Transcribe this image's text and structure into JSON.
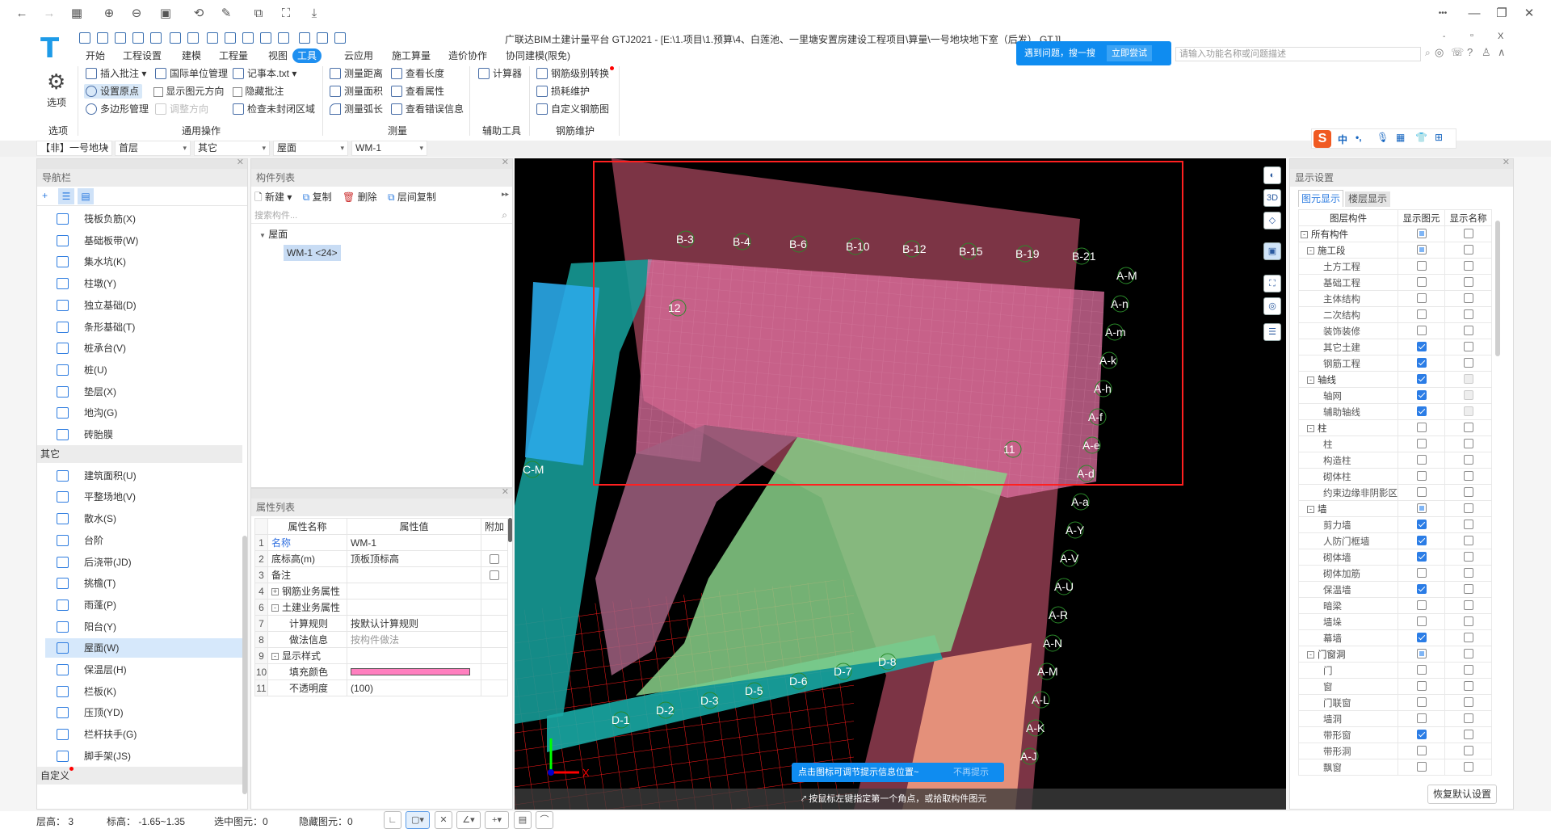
{
  "topbar": {
    "icons": [
      "back-arrow-icon",
      "forward-arrow-icon",
      "apps-grid-icon",
      "zoom-in-icon",
      "zoom-out-icon",
      "actual-size-icon",
      "rotate-icon",
      "edit-icon",
      "translate-icon",
      "screenshot-icon",
      "download-icon"
    ],
    "more": "•••",
    "minimize": "—",
    "restore": "❐",
    "close": "✕"
  },
  "app": {
    "logo": "T",
    "title": "广联达BIM土建计量平台 GTJ2021 - [E:\\1.项目\\1.预算\\4、白莲池、一里塘安置房建设工程项目\\算量\\一号地块地下室（后发）.GTJ]",
    "menus": [
      "开始",
      "工程设置",
      "建模",
      "工程量",
      "视图",
      "工具",
      "云应用",
      "施工算量",
      "造价协作",
      "协同建模(限免)"
    ],
    "active_menu": "工具",
    "banner_text": "遇到问题，搜一搜",
    "banner_try": "立即尝试",
    "search_placeholder": "请输入功能名称或问题描述",
    "win_min": "-",
    "win_restore": "▫",
    "win_close": "X"
  },
  "ribbon": {
    "options_label": "选项",
    "groups": [
      {
        "label": "选项"
      },
      {
        "label": "通用操作"
      },
      {
        "label": "测量"
      },
      {
        "label": "辅助工具"
      },
      {
        "label": "钢筋维护"
      }
    ],
    "items": {
      "insert_note": "插入批注",
      "unit_mgmt": "国际单位管理",
      "notepad": "记事本.txt",
      "set_origin": "设置原点",
      "show_direction": "显示图元方向",
      "hide_note": "隐藏批注",
      "polygon_mgmt": "多边形管理",
      "adjust_direction": "调整方向",
      "check_unclosed": "检查未封闭区域",
      "measure_distance": "测量距离",
      "view_length": "查看长度",
      "measure_area": "测量面积",
      "view_property": "查看属性",
      "measure_arc": "测量弧长",
      "view_errors": "查看错误信息",
      "calculator": "计算器",
      "rebar_grade": "钢筋级别转换",
      "loss_maintain": "损耗维护",
      "custom_rebar": "自定义钢筋图"
    }
  },
  "selectors": [
    "【非】一号地块",
    "首层",
    "其它",
    "屋面",
    "WM-1"
  ],
  "nav": {
    "title": "导航栏",
    "items_a": [
      "筏板负筋(X)",
      "基础板带(W)",
      "集水坑(K)",
      "柱墩(Y)",
      "独立基础(D)",
      "条形基础(T)",
      "桩承台(V)",
      "桩(U)",
      "垫层(X)",
      "地沟(G)",
      "砖胎膜"
    ],
    "group_other": "其它",
    "items_b": [
      "建筑面积(U)",
      "平整场地(V)",
      "散水(S)",
      "台阶",
      "后浇带(JD)",
      "挑檐(T)",
      "雨蓬(P)",
      "阳台(Y)",
      "屋面(W)",
      "保温层(H)",
      "栏板(K)",
      "压顶(YD)",
      "栏杆扶手(G)",
      "脚手架(JS)"
    ],
    "selected": "屋面(W)",
    "group_custom": "自定义"
  },
  "components": {
    "title": "构件列表",
    "new": "新建",
    "copy": "复制",
    "delete": "删除",
    "floor_copy": "层间复制",
    "search_placeholder": "搜索构件...",
    "tree_root": "屋面",
    "tree_item": "WM-1 <24>"
  },
  "properties": {
    "title": "属性列表",
    "headers": [
      "属性名称",
      "属性值",
      "附加"
    ],
    "fill_color": "#ff7fbf",
    "rows": [
      {
        "num": "1",
        "name": "名称",
        "value": "WM-1",
        "extra": "none",
        "indent": 0,
        "link": true
      },
      {
        "num": "2",
        "name": "底标高(m)",
        "value": "顶板顶标高",
        "extra": "checkbox",
        "indent": 0
      },
      {
        "num": "3",
        "name": "备注",
        "value": "",
        "extra": "checkbox",
        "indent": 0
      },
      {
        "num": "4",
        "name": "钢筋业务属性",
        "value": "",
        "extra": "none",
        "indent": 0,
        "toggle": "+"
      },
      {
        "num": "6",
        "name": "土建业务属性",
        "value": "",
        "extra": "none",
        "indent": 0,
        "toggle": "-"
      },
      {
        "num": "7",
        "name": "计算规则",
        "value": "按默认计算规则",
        "extra": "none",
        "indent": 1
      },
      {
        "num": "8",
        "name": "做法信息",
        "value": "按构件做法",
        "extra": "none",
        "indent": 1,
        "muted": true
      },
      {
        "num": "9",
        "name": "显示样式",
        "value": "",
        "extra": "none",
        "indent": 0,
        "toggle": "-"
      },
      {
        "num": "10",
        "name": "填充颜色",
        "value": "",
        "extra": "none",
        "indent": 1,
        "swatch": true
      },
      {
        "num": "11",
        "name": "不透明度",
        "value": "(100)",
        "extra": "none",
        "indent": 1
      }
    ]
  },
  "canvas": {
    "hint_tooltip": "点击图标可调节提示信息位置~",
    "hint_dismiss": "不再提示",
    "prompt": "按鼠标左键指定第一个角点，或拾取构件图元",
    "axis_x": "X",
    "labels": [
      "B-3",
      "B-4",
      "B-6",
      "B-10",
      "B-12",
      "B-15",
      "B-19",
      "B-21",
      "A-M",
      "A-n",
      "A-m",
      "A-k",
      "A-h",
      "A-f",
      "A-e",
      "A-d",
      "A-a",
      "A-Y",
      "A-V",
      "A-U",
      "A-R",
      "A-N",
      "A-M",
      "A-L",
      "A-K",
      "A-J",
      "C-M",
      "D-1",
      "D-2",
      "D-3",
      "D-5",
      "D-6",
      "D-7",
      "D-8",
      "11",
      "12"
    ],
    "colors": {
      "background": "#000000",
      "selection": "#ff2020",
      "roof": "#c0506a",
      "teal": "#1aa3a0",
      "green": "#7cc87c",
      "blue": "#2aa8e8",
      "grid": "#ff1a1a"
    }
  },
  "display": {
    "title": "显示设置",
    "tabs": [
      "图元显示",
      "楼层显示"
    ],
    "headers": [
      "图层构件",
      "显示图元",
      "显示名称"
    ],
    "rows": [
      {
        "name": "所有构件",
        "level": 0,
        "toggle": "-",
        "show": "partial",
        "label": "off"
      },
      {
        "name": "施工段",
        "level": 1,
        "toggle": "-",
        "show": "partial",
        "label": "off"
      },
      {
        "name": "土方工程",
        "level": 2,
        "show": "off",
        "label": "off"
      },
      {
        "name": "基础工程",
        "level": 2,
        "show": "off",
        "label": "off"
      },
      {
        "name": "主体结构",
        "level": 2,
        "show": "off",
        "label": "off"
      },
      {
        "name": "二次结构",
        "level": 2,
        "show": "off",
        "label": "off"
      },
      {
        "name": "装饰装修",
        "level": 2,
        "show": "off",
        "label": "off"
      },
      {
        "name": "其它土建",
        "level": 2,
        "show": "on",
        "label": "off"
      },
      {
        "name": "钢筋工程",
        "level": 2,
        "show": "on",
        "label": "off"
      },
      {
        "name": "轴线",
        "level": 1,
        "toggle": "-",
        "show": "on",
        "label": "disabled"
      },
      {
        "name": "轴网",
        "level": 2,
        "show": "on",
        "label": "disabled"
      },
      {
        "name": "辅助轴线",
        "level": 2,
        "show": "on",
        "label": "disabled"
      },
      {
        "name": "柱",
        "level": 1,
        "toggle": "-",
        "show": "off",
        "label": "off"
      },
      {
        "name": "柱",
        "level": 2,
        "show": "off",
        "label": "off"
      },
      {
        "name": "构造柱",
        "level": 2,
        "show": "off",
        "label": "off"
      },
      {
        "name": "砌体柱",
        "level": 2,
        "show": "off",
        "label": "off"
      },
      {
        "name": "约束边缘非阴影区",
        "level": 2,
        "show": "off",
        "label": "off"
      },
      {
        "name": "墙",
        "level": 1,
        "toggle": "-",
        "show": "partial",
        "label": "off"
      },
      {
        "name": "剪力墙",
        "level": 2,
        "show": "on",
        "label": "off"
      },
      {
        "name": "人防门框墙",
        "level": 2,
        "show": "on",
        "label": "off"
      },
      {
        "name": "砌体墙",
        "level": 2,
        "show": "on",
        "label": "off"
      },
      {
        "name": "砌体加筋",
        "level": 2,
        "show": "off",
        "label": "off"
      },
      {
        "name": "保温墙",
        "level": 2,
        "show": "on",
        "label": "off"
      },
      {
        "name": "暗梁",
        "level": 2,
        "show": "off",
        "label": "off"
      },
      {
        "name": "墙垛",
        "level": 2,
        "show": "off",
        "label": "off"
      },
      {
        "name": "幕墙",
        "level": 2,
        "show": "on",
        "label": "off"
      },
      {
        "name": "门窗洞",
        "level": 1,
        "toggle": "-",
        "show": "partial",
        "label": "off"
      },
      {
        "name": "门",
        "level": 2,
        "show": "off",
        "label": "off"
      },
      {
        "name": "窗",
        "level": 2,
        "show": "off",
        "label": "off"
      },
      {
        "name": "门联窗",
        "level": 2,
        "show": "off",
        "label": "off"
      },
      {
        "name": "墙洞",
        "level": 2,
        "show": "off",
        "label": "off"
      },
      {
        "name": "带形窗",
        "level": 2,
        "show": "on",
        "label": "off"
      },
      {
        "name": "带形洞",
        "level": 2,
        "show": "off",
        "label": "off"
      },
      {
        "name": "飘窗",
        "level": 2,
        "show": "off",
        "label": "off"
      }
    ],
    "reset": "恢复默认设置"
  },
  "ime": {
    "logo": "S",
    "mode": "中",
    "punct": "•,"
  },
  "status": {
    "floor_height": "层高：  3",
    "elevation": "标高：  -1.65~1.35",
    "selected": "选中图元：0",
    "hidden": "隐藏图元：0",
    "tools": [
      "ortho-icon",
      "select-rect-icon",
      "cross-icon",
      "angle-icon",
      "offset-icon",
      "snap-icon",
      "arc-icon"
    ]
  }
}
